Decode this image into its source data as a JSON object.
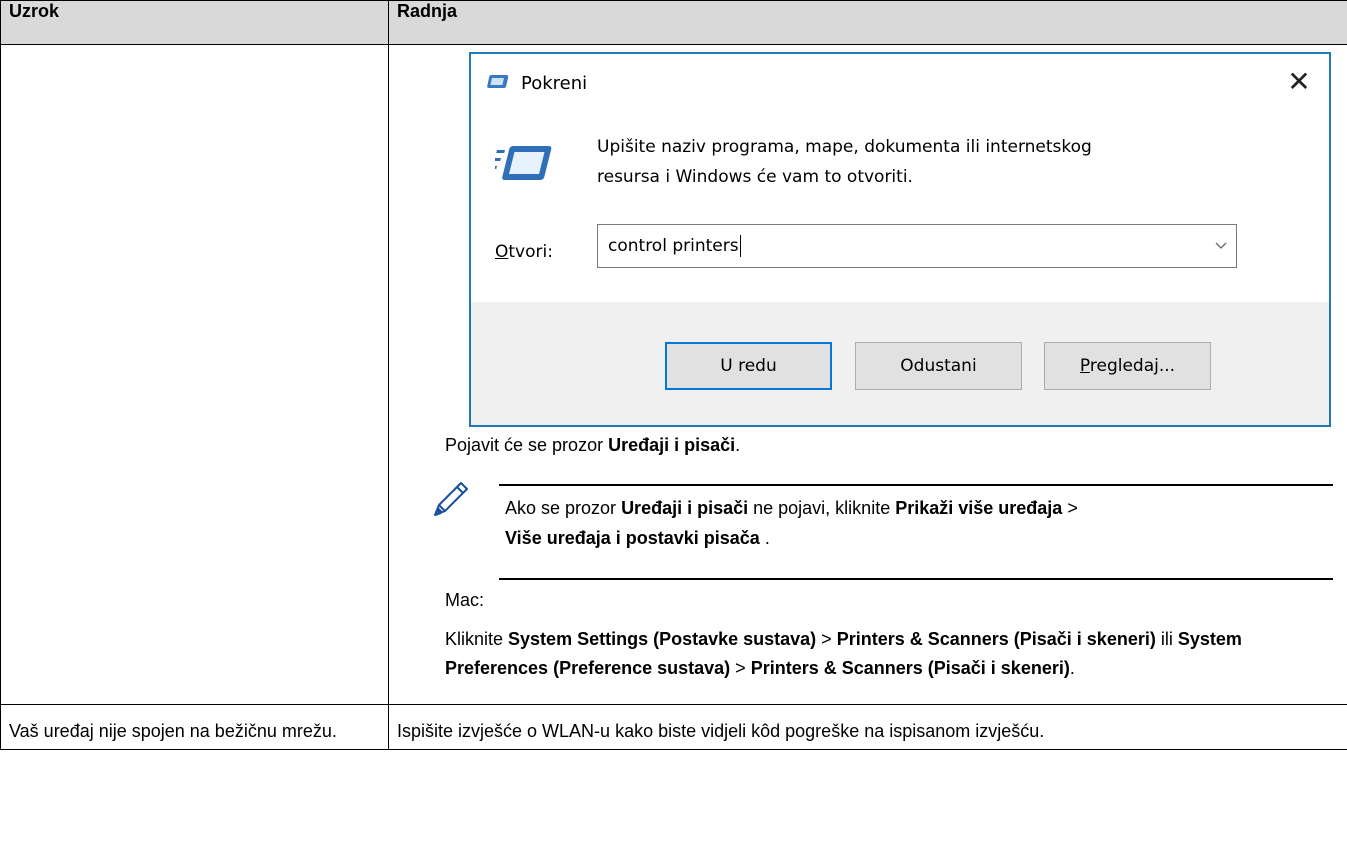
{
  "table": {
    "header_cause": "Uzrok",
    "header_action": "Radnja"
  },
  "run_dialog": {
    "title": "Pokreni",
    "description_line1": "Upišite naziv programa, mape, dokumenta ili internetskog",
    "description_line2": "resursa i Windows će vam to otvoriti.",
    "open_label_first": "O",
    "open_label_rest": "tvori:",
    "input_value": "control printers",
    "ok_label": "U redu",
    "cancel_label": "Odustani",
    "browse_label_first": "P",
    "browse_label_rest": "regledaj..."
  },
  "steps": {
    "appears_prefix": "Pojavit će se prozor ",
    "appears_bold": "Uređaji i pisači",
    "appears_suffix": ".",
    "note_prefix": "Ako se prozor ",
    "note_bold1": "Uređaji i pisači",
    "note_mid": " ne pojavi, kliknite ",
    "note_bold2": "Prikaži više uređaja",
    "note_gt": " >",
    "note_bold3": "Više uređaja i postavki pisača",
    "note_suffix": " .",
    "mac_label": "Mac:",
    "mac_prefix": "Kliknite ",
    "mac_bold1": "System Settings (Postavke sustava)",
    "mac_gt1": " > ",
    "mac_bold2": "Printers & Scanners (Pisači i skeneri)",
    "mac_or": " ili ",
    "mac_bold3": "System Preferences (Preference sustava)",
    "mac_gt2": " > ",
    "mac_bold4": "Printers & Scanners (Pisači i skeneri)",
    "mac_suffix": "."
  },
  "row2": {
    "cause": "Vaš uređaj nije spojen na bežičnu mrežu.",
    "action": "Ispišite izvješće o WLAN-u kako biste vidjeli kôd pogreške na ispisanom izvješću."
  },
  "icons": {
    "run_small": "run-app-icon",
    "run_large": "run-app-icon",
    "close": "close-icon",
    "dropdown": "chevron-down-icon",
    "note": "pencil-note-icon"
  },
  "colors": {
    "header_bg": "#d9d9d9",
    "dialog_border": "#1e7bb8",
    "default_button_border": "#0078d7",
    "dialog_footer_bg": "#f0f0f0"
  }
}
